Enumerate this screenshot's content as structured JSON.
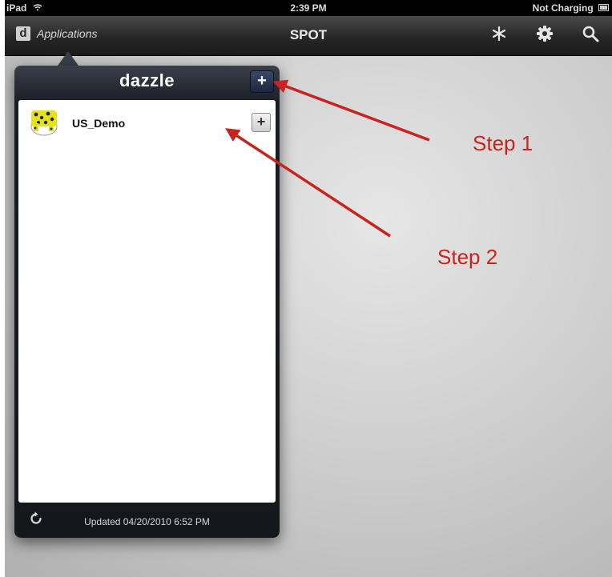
{
  "status_bar": {
    "device": "iPad",
    "time": "2:39 PM",
    "battery_status": "Not Charging",
    "wifi_icon": "wifi-icon",
    "battery_icon": "battery-icon"
  },
  "nav_bar": {
    "app_logo": "d",
    "apps_label": "Applications",
    "title": "SPOT",
    "icons": [
      "snowflake-icon",
      "gear-icon",
      "search-icon"
    ]
  },
  "popover": {
    "title": "dazzle",
    "add_button_label": "+",
    "items": [
      {
        "label": "US_Demo",
        "icon": "app-icon",
        "add_label": "+"
      }
    ],
    "footer": {
      "refresh_icon": "refresh-icon",
      "updated_text": "Updated 04/20/2010 6:52 PM"
    }
  },
  "annotations": {
    "step1": "Step 1",
    "step2": "Step 2",
    "color": "#c8241f"
  }
}
